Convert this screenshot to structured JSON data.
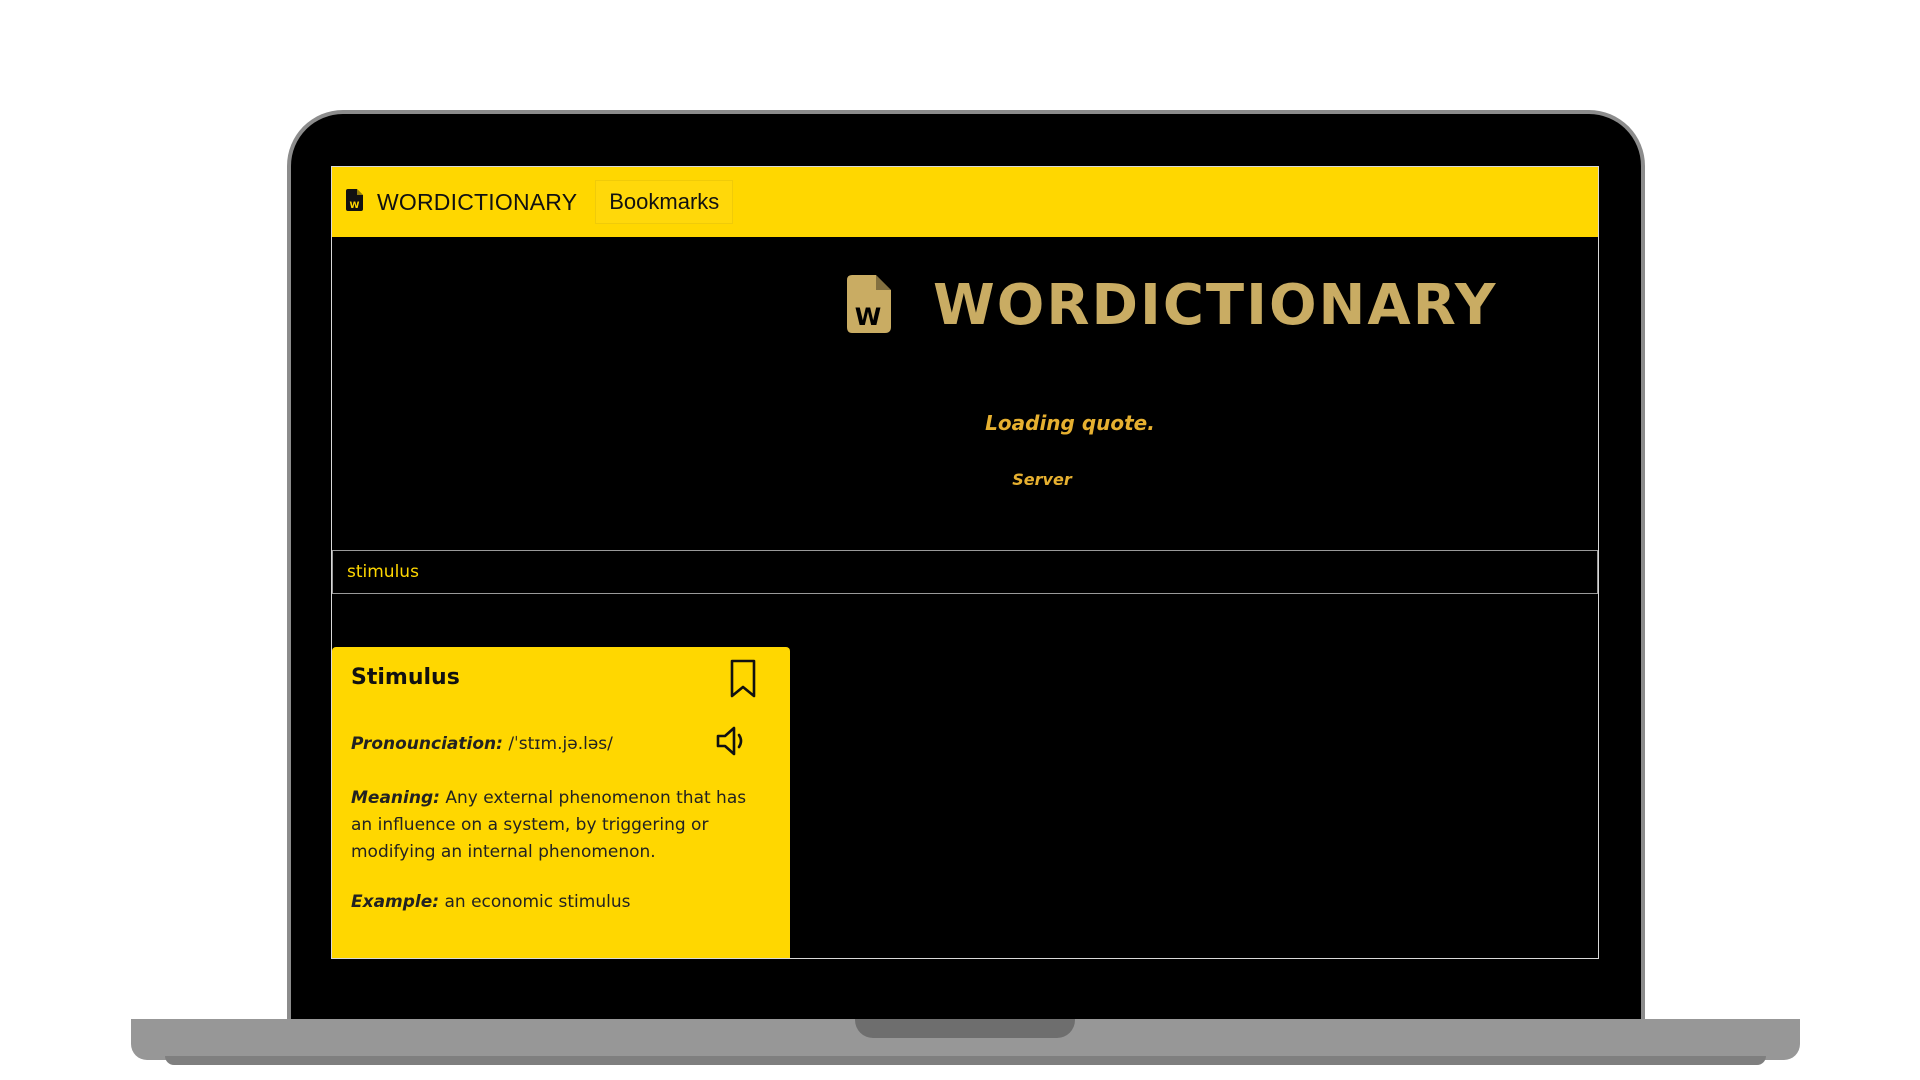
{
  "navbar": {
    "brand": "WORDICTIONARY",
    "bookmarks_label": "Bookmarks"
  },
  "hero": {
    "title": "WORDICTIONARY"
  },
  "quote": {
    "text": "Loading quote.",
    "author": "Server"
  },
  "search": {
    "value": "stimulus"
  },
  "card": {
    "word": "Stimulus",
    "pronunciation_label": "Pronounciation:",
    "pronunciation": "/ˈstɪm.jə.ləs/",
    "meaning_label": "Meaning:",
    "meaning": "Any external phenomenon that has an influence on a system, by triggering or modifying an internal phenomenon.",
    "example_label": "Example:",
    "example": "an economic stimulus"
  },
  "icons": {
    "brand_icon": "word-file-icon",
    "hero_icon": "word-file-icon",
    "bookmark_icon": "bookmark-icon",
    "speaker_icon": "speaker-icon"
  },
  "colors": {
    "accent": "#ffd700",
    "background": "#000000",
    "hero_gold": "#c9ac63",
    "quote": "#e6b030"
  }
}
